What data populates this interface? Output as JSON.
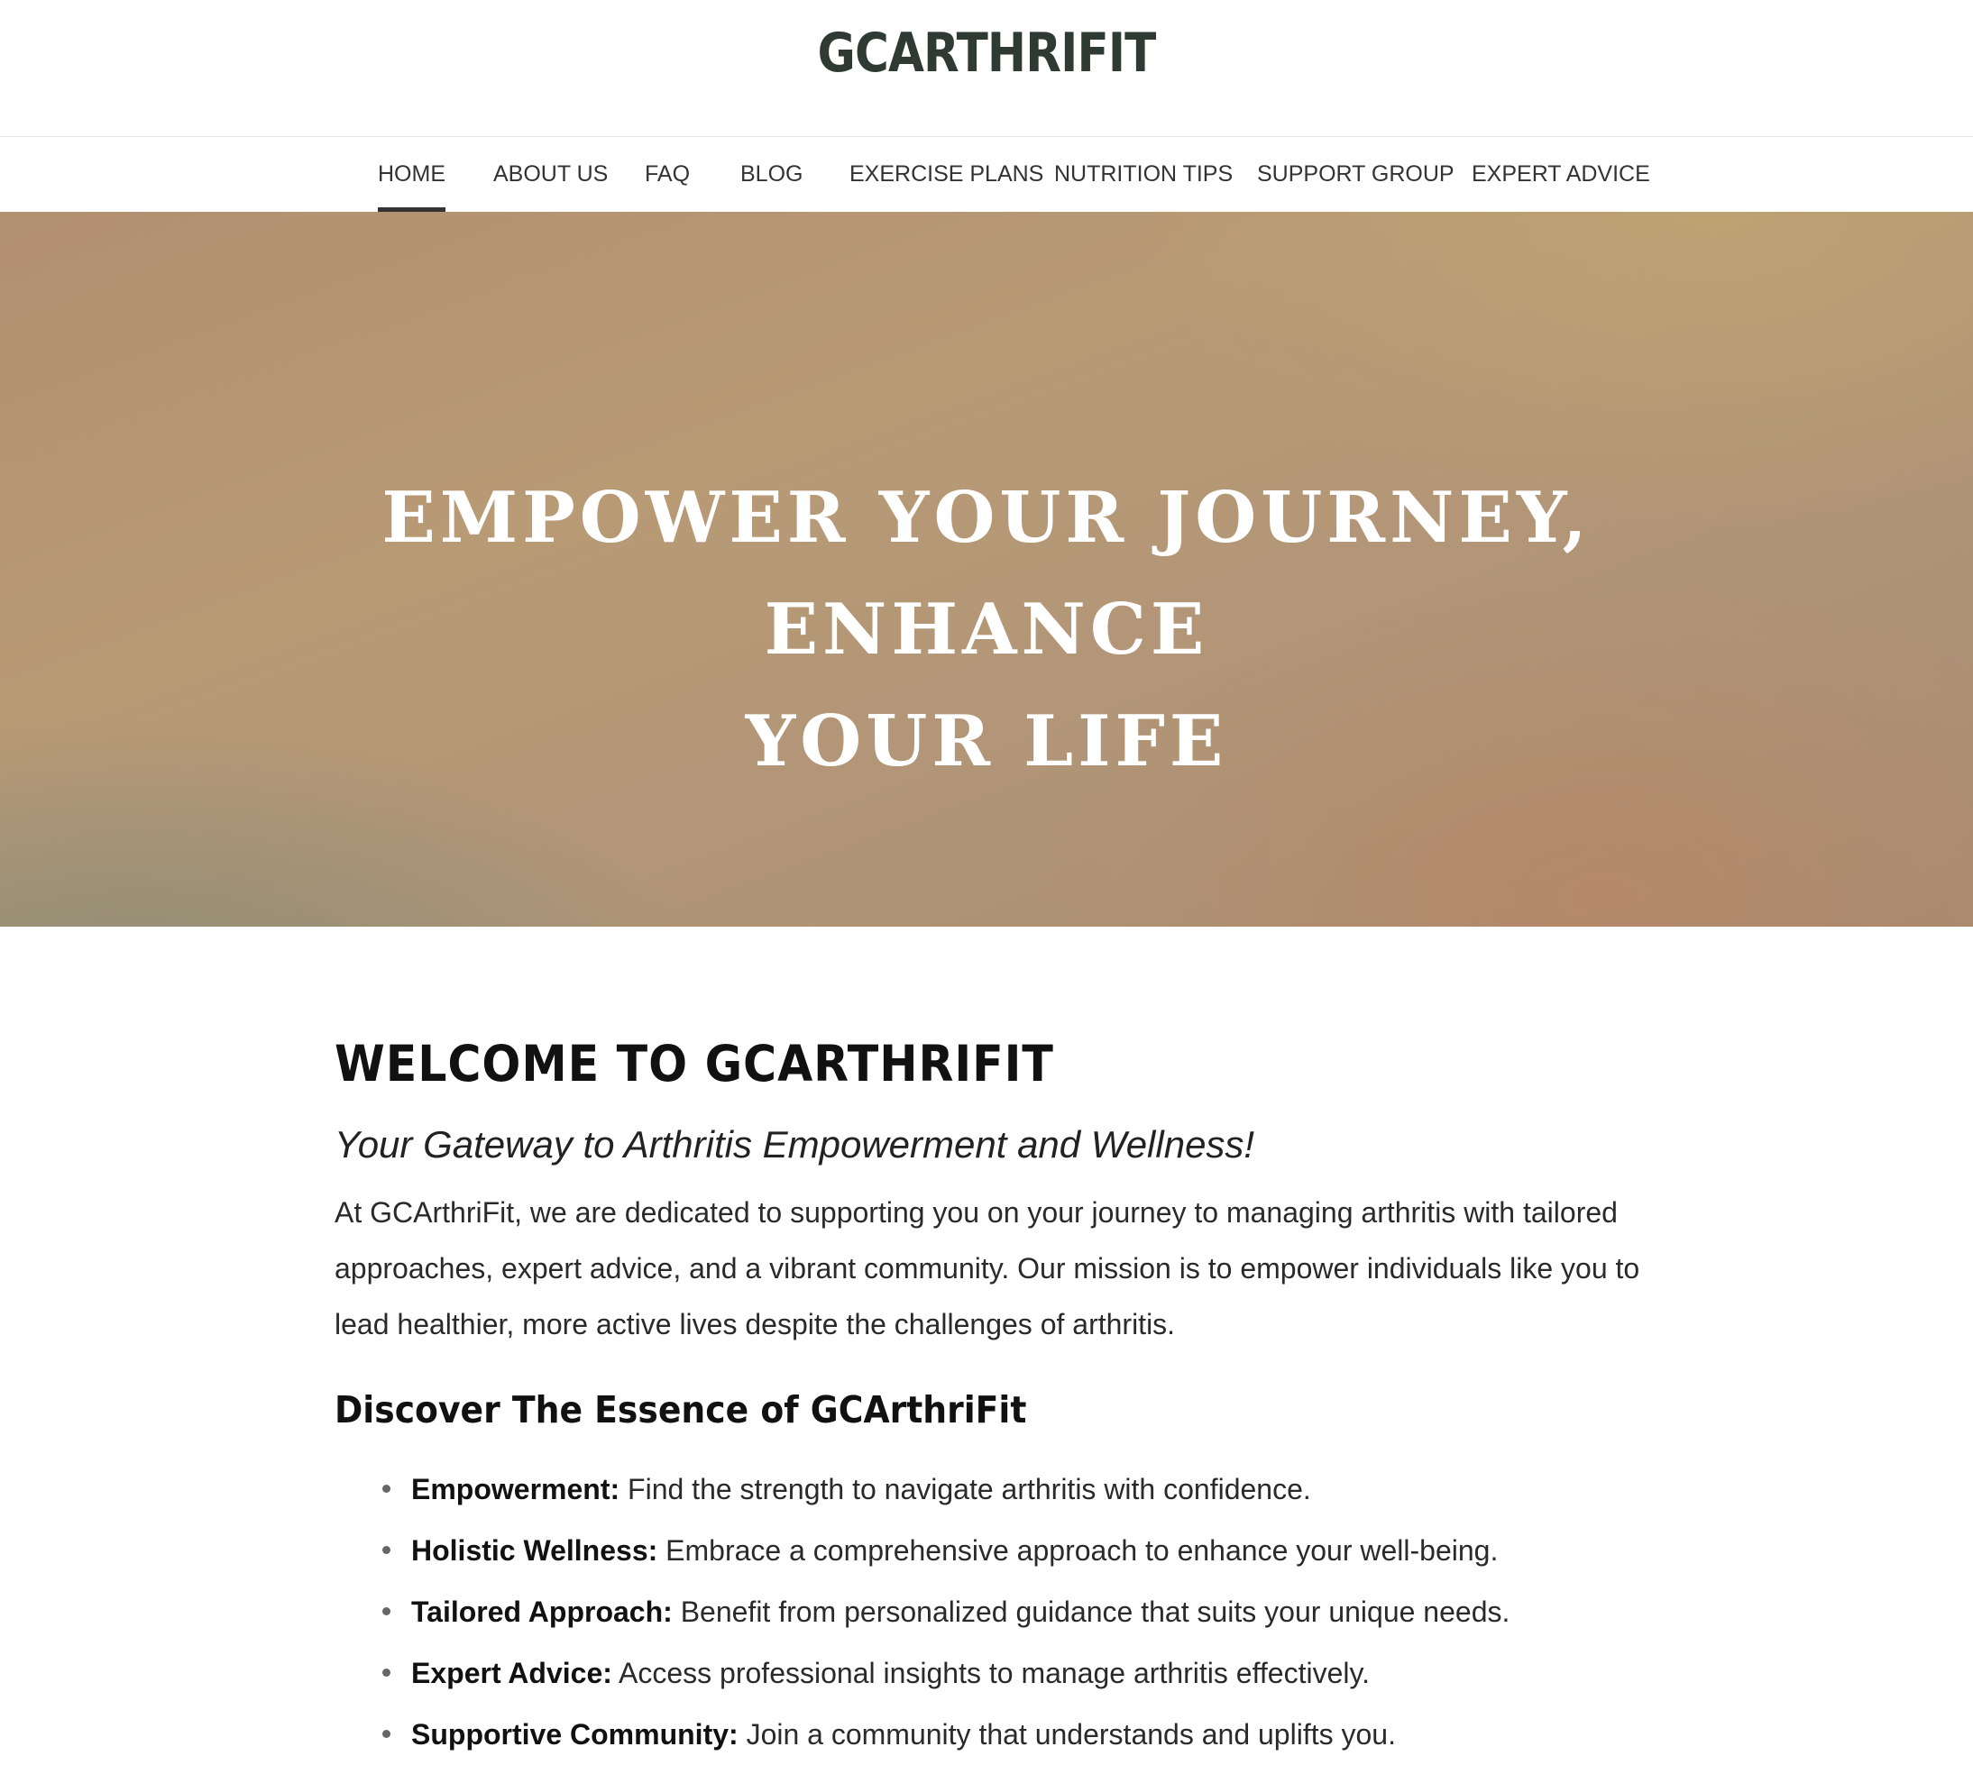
{
  "header": {
    "site_title": "GCARTHRIFIT"
  },
  "nav": {
    "items": [
      {
        "label": "HOME",
        "active": true
      },
      {
        "label": "ABOUT US"
      },
      {
        "label": "FAQ"
      },
      {
        "label": "BLOG"
      },
      {
        "label": "EXERCISE PLANS"
      },
      {
        "label": "NUTRITION TIPS"
      },
      {
        "label": "SUPPORT GROUP"
      },
      {
        "label": "EXPERT ADVICE"
      }
    ]
  },
  "hero": {
    "line1": "EMPOWER YOUR JOURNEY, ENHANCE",
    "line2": "YOUR LIFE"
  },
  "welcome": {
    "title": "WELCOME TO GCARTHRIFIT",
    "tagline": "Your Gateway to Arthritis Empowerment and Wellness!",
    "intro": "At GCArthriFit, we are dedicated to supporting you on your journey to managing arthritis with tailored approaches, expert advice, and a vibrant community. Our mission is to empower individuals like you to lead healthier, more active lives despite the challenges of arthritis."
  },
  "essence": {
    "title": "Discover The Essence of GCArthriFit",
    "features": [
      {
        "label": "Empowerment:",
        "text": " Find the strength to navigate arthritis with confidence."
      },
      {
        "label": "Holistic Wellness:",
        "text": " Embrace a comprehensive approach to enhance your well-being."
      },
      {
        "label": "Tailored Approach:",
        "text": " Benefit from personalized guidance that suits your unique needs."
      },
      {
        "label": "Expert Advice:",
        "text": " Access professional insights to manage arthritis effectively."
      },
      {
        "label": "Supportive Community:",
        "text": " Join a community that understands and uplifts you."
      }
    ]
  },
  "colors": {
    "title_text": "#2f3a33",
    "hero_tan": "#b89a75",
    "nav_underline": "#333333"
  }
}
